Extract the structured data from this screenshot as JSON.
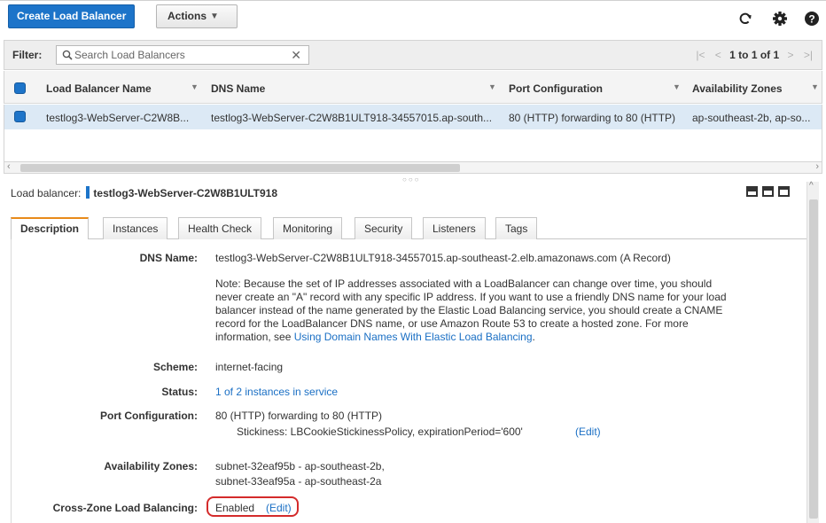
{
  "toolbar": {
    "create_label": "Create Load Balancer",
    "actions_label": "Actions",
    "icons": [
      "refresh-icon",
      "gear-icon",
      "help-icon"
    ]
  },
  "filter": {
    "label": "Filter:",
    "placeholder": "Search Load Balancers",
    "pager_text": "1 to 1 of 1"
  },
  "table": {
    "columns": [
      "Load Balancer Name",
      "DNS Name",
      "Port Configuration",
      "Availability Zones"
    ],
    "rows": [
      {
        "name": "testlog3-WebServer-C2W8B...",
        "dns": "testlog3-WebServer-C2W8B1ULT918-34557015.ap-south...",
        "port": "80 (HTTP) forwarding to 80 (HTTP)",
        "zones": "ap-southeast-2b, ap-so..."
      }
    ]
  },
  "detail": {
    "title_prefix": "Load balancer:",
    "title_name": "testlog3-WebServer-C2W8B1ULT918",
    "tabs": [
      "Description",
      "Instances",
      "Health Check",
      "Monitoring",
      "Security",
      "Listeners",
      "Tags"
    ],
    "active_tab": "Description",
    "dns_label": "DNS Name:",
    "dns_value": "testlog3-WebServer-C2W8B1ULT918-34557015.ap-southeast-2.elb.amazonaws.com (A Record)",
    "note_text": "Note: Because the set of IP addresses associated with a LoadBalancer can change over time, you should never create an \"A\" record with any specific IP address. If you want to use a friendly DNS name for your load balancer instead of the name generated by the Elastic Load Balancing service, you should create a CNAME record for the LoadBalancer DNS name, or use Amazon Route 53 to create a hosted zone. For more information, see",
    "note_link": "Using Domain Names With Elastic Load Balancing",
    "note_end": ".",
    "scheme_label": "Scheme:",
    "scheme_value": "internet-facing",
    "status_label": "Status:",
    "status_value": "1 of 2 instances in service",
    "port_label": "Port Configuration:",
    "port_value": "80 (HTTP) forwarding to 80 (HTTP)",
    "stickiness_value": "Stickiness: LBCookieStickinessPolicy, expirationPeriod='600'",
    "edit_label": "(Edit)",
    "az_label": "Availability Zones:",
    "az_values": [
      "subnet-32eaf95b - ap-southeast-2b,",
      "subnet-33eaf95a - ap-southeast-2a"
    ],
    "cross_zone_label": "Cross-Zone Load Balancing:",
    "cross_zone_value": "Enabled",
    "cross_zone_edit": "(Edit)"
  },
  "colors": {
    "primary": "#1d74c9",
    "link": "#1a6fc4",
    "active_tab_accent": "#e88a1a",
    "highlight": "#d42b2b",
    "selected_row": "#dce9f5"
  }
}
